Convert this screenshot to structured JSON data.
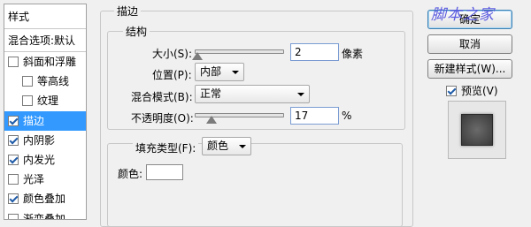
{
  "styles_panel": {
    "title": "样式",
    "blend_options": "混合选项:默认",
    "items": [
      {
        "label": "斜面和浮雕",
        "checked": false
      },
      {
        "label": "等高线",
        "checked": false
      },
      {
        "label": "纹理",
        "checked": false
      },
      {
        "label": "描边",
        "checked": true
      },
      {
        "label": "内阴影",
        "checked": true
      },
      {
        "label": "内发光",
        "checked": true
      },
      {
        "label": "光泽",
        "checked": false
      },
      {
        "label": "颜色叠加",
        "checked": true
      },
      {
        "label": "渐变叠加",
        "checked": false
      }
    ]
  },
  "stroke": {
    "section_title": "描边",
    "structure_title": "结构",
    "size_label": "大小(S):",
    "size_value": "2",
    "size_unit": "像素",
    "position_label": "位置(P):",
    "position_value": "内部",
    "blend_mode_label": "混合模式(B):",
    "blend_mode_value": "正常",
    "opacity_label": "不透明度(O):",
    "opacity_value": "17",
    "opacity_unit": "%",
    "fill_type_label": "填充类型(F):",
    "fill_type_value": "颜色",
    "color_label": "颜色:",
    "color_value": "#ffffff"
  },
  "buttons": {
    "ok": "确定",
    "cancel": "取消",
    "new_style": "新建样式(W)...",
    "preview_label": "预览(V)",
    "preview_checked": true
  },
  "watermark": "脚本之家"
}
